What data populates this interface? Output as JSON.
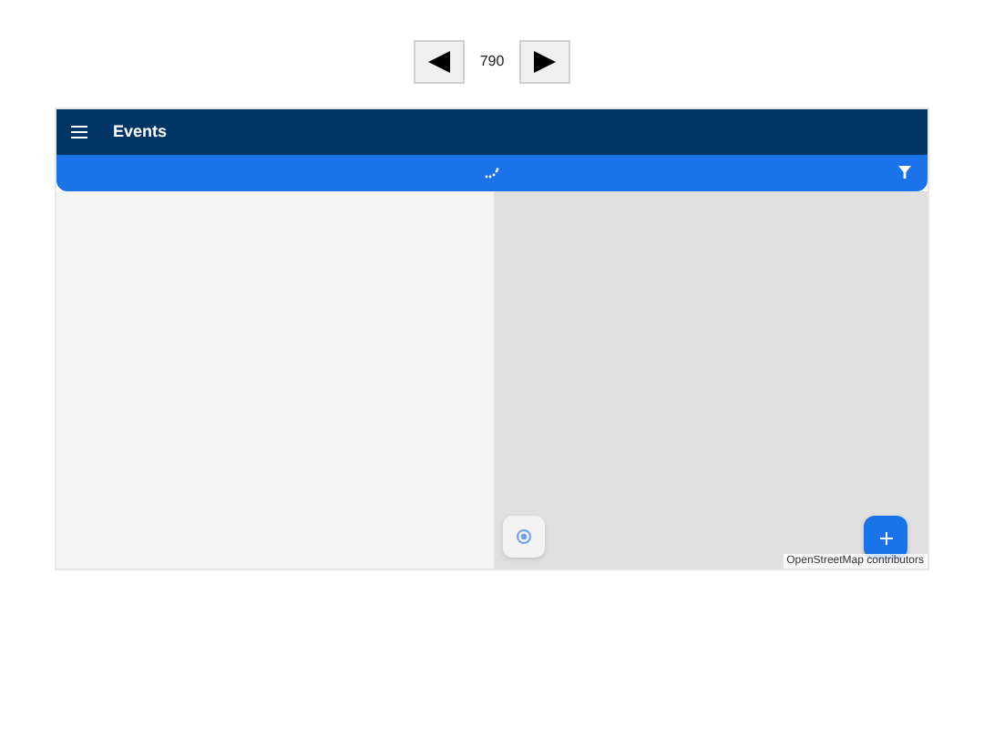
{
  "pager": {
    "value": "790"
  },
  "app_bar": {
    "title": "Events"
  },
  "map": {
    "attribution": "OpenStreetMap contributors"
  }
}
